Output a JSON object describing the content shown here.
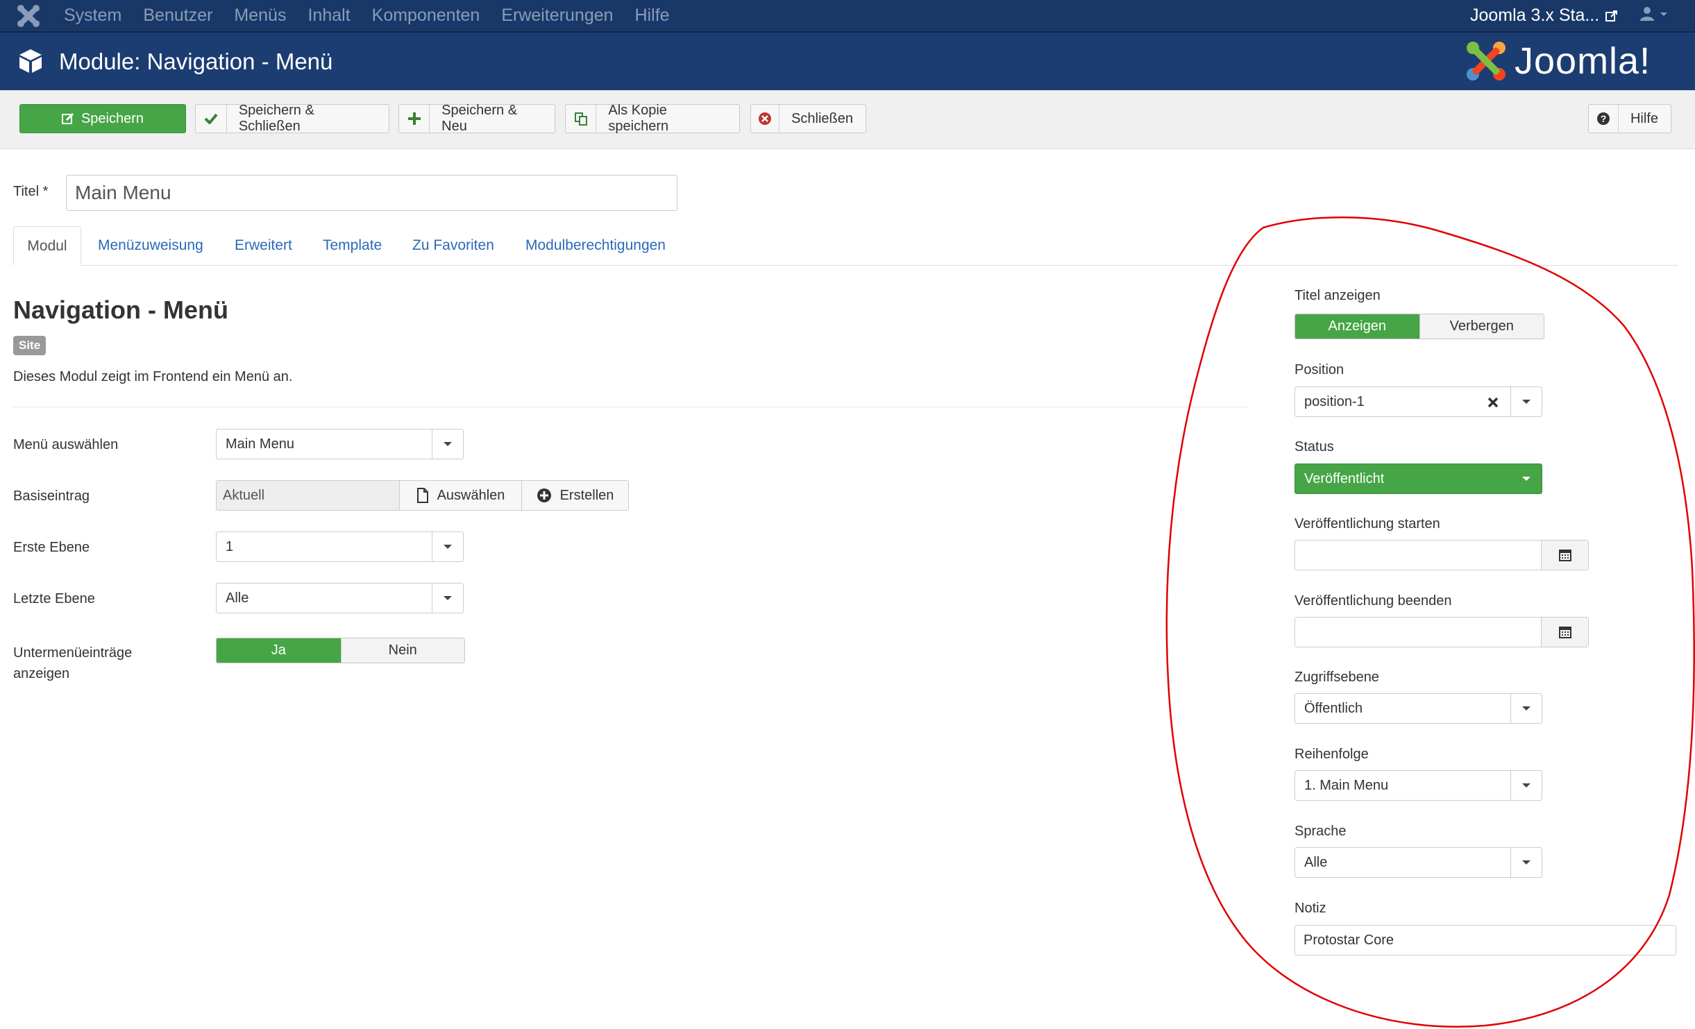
{
  "topbar": {
    "menu": [
      "System",
      "Benutzer",
      "Menüs",
      "Inhalt",
      "Komponenten",
      "Erweiterungen",
      "Hilfe"
    ],
    "site_link": "Joomla 3.x Sta..."
  },
  "header": {
    "title": "Module: Navigation - Menü",
    "brand": "Joomla!"
  },
  "toolbar": {
    "save": "Speichern",
    "save_close": "Speichern & Schließen",
    "save_new": "Speichern & Neu",
    "save_copy": "Als Kopie speichern",
    "close": "Schließen",
    "help": "Hilfe"
  },
  "form": {
    "title_label": "Titel *",
    "title_value": "Main Menu"
  },
  "tabs": [
    "Modul",
    "Menüzuweisung",
    "Erweitert",
    "Template",
    "Zu Favoriten",
    "Modulberechtigungen"
  ],
  "module": {
    "heading": "Navigation - Menü",
    "badge": "Site",
    "description": "Dieses Modul zeigt im Frontend ein Menü an.",
    "menu_label": "Menü auswählen",
    "menu_value": "Main Menu",
    "base_label": "Basiseintrag",
    "base_value": "Aktuell",
    "base_select": "Auswählen",
    "base_create": "Erstellen",
    "start_level_label": "Erste Ebene",
    "start_level_value": "1",
    "end_level_label": "Letzte Ebene",
    "end_level_value": "Alle",
    "submenu_label_line1": "Untermenüeinträge",
    "submenu_label_line2": "anzeigen",
    "yes": "Ja",
    "no": "Nein"
  },
  "sidebar": {
    "show_title_label": "Titel anzeigen",
    "show": "Anzeigen",
    "hide": "Verbergen",
    "position_label": "Position",
    "position_value": "position-1",
    "status_label": "Status",
    "status_value": "Veröffentlicht",
    "publish_up_label": "Veröffentlichung starten",
    "publish_down_label": "Veröffentlichung beenden",
    "access_label": "Zugriffsebene",
    "access_value": "Öffentlich",
    "ordering_label": "Reihenfolge",
    "ordering_value": "1. Main Menu",
    "language_label": "Sprache",
    "language_value": "Alle",
    "note_label": "Notiz",
    "note_value": "Protostar Core"
  },
  "colors": {
    "topbar": "#1a3867",
    "header": "#1c3d72",
    "success": "#46a546",
    "link": "#2a69b8",
    "annotation": "#e00000"
  }
}
